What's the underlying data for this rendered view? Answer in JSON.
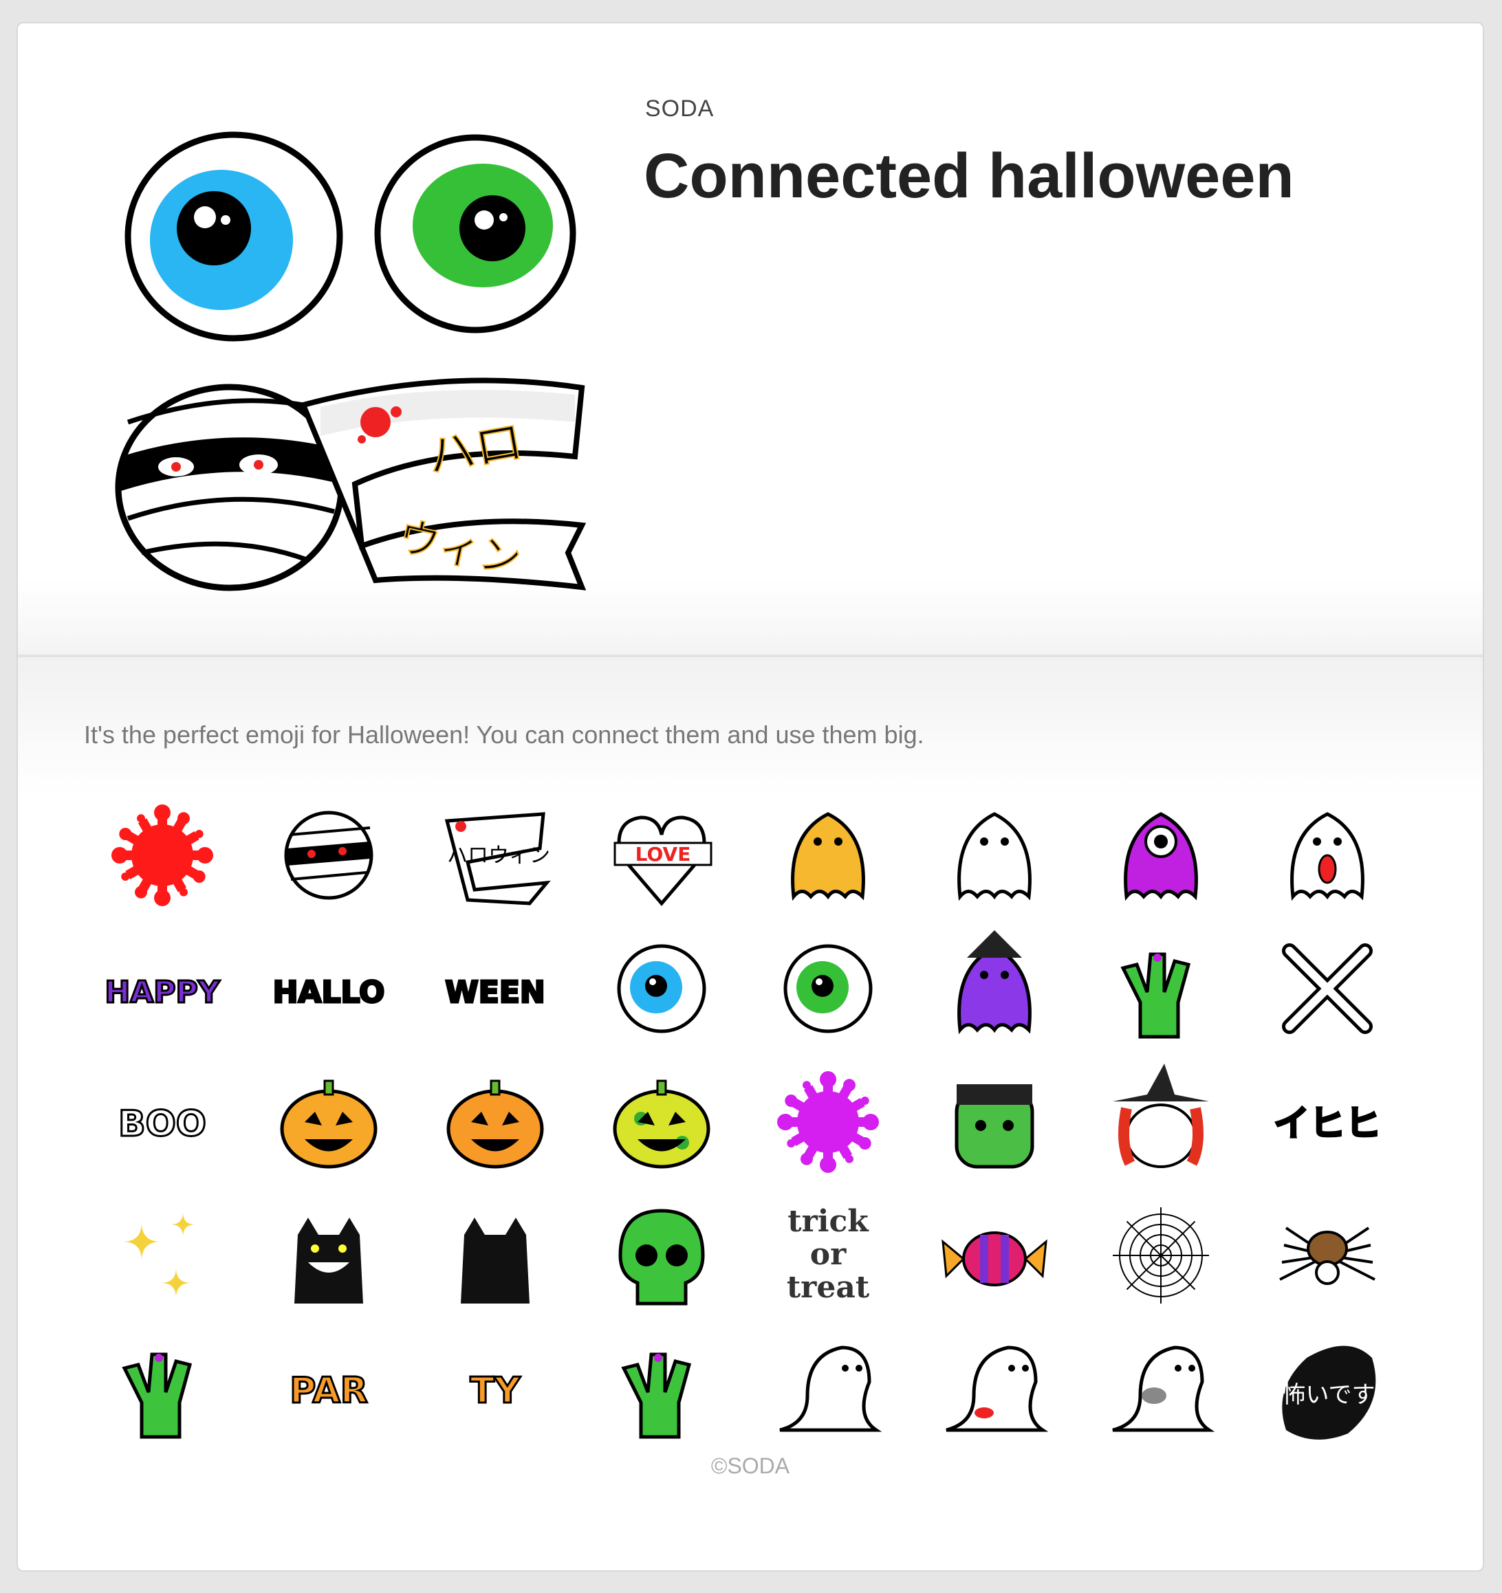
{
  "product": {
    "author": "SODA",
    "title": "Connected halloween",
    "description": "It's the perfect emoji for Halloween! You can connect them and use them big.",
    "copyright": "©SODA"
  },
  "main_image": {
    "icon": "mummy-eyeballs-main-art",
    "text_jp_1": "ハロ",
    "text_jp_2": "ウィン"
  },
  "emoji": [
    {
      "icon": "blood-splat-icon",
      "color": "#ff1a1a"
    },
    {
      "icon": "mummy-face-icon",
      "color": "#ffffff"
    },
    {
      "icon": "bandage-banner-icon",
      "color": "#ffffff",
      "text": "ハロウィン"
    },
    {
      "icon": "love-heart-icon",
      "color": "#ffffff",
      "text": "LOVE"
    },
    {
      "icon": "yellow-ghost-icon",
      "color": "#f5b82e"
    },
    {
      "icon": "white-ghost-icon",
      "color": "#ffffff"
    },
    {
      "icon": "purple-cyclops-ghost-icon",
      "color": "#c020e0"
    },
    {
      "icon": "tongue-ghost-icon",
      "color": "#ffffff"
    },
    {
      "icon": "happy-text-icon",
      "color": "#7a2fd0",
      "text": "HAPPY"
    },
    {
      "icon": "hallo-text-icon",
      "color": "#000000",
      "text": "HALLO"
    },
    {
      "icon": "ween-text-icon",
      "color": "#000000",
      "text": "WEEN"
    },
    {
      "icon": "blue-eyeball-icon",
      "color": "#27b3f2"
    },
    {
      "icon": "green-eyeball-icon",
      "color": "#36c037"
    },
    {
      "icon": "witch-ghost-icon",
      "color": "#8a38e8"
    },
    {
      "icon": "zombie-ok-hand-icon",
      "color": "#3ec43c"
    },
    {
      "icon": "crossbones-icon",
      "color": "#ffffff"
    },
    {
      "icon": "boo-text-icon",
      "color": "#ffffff",
      "text": "BOO"
    },
    {
      "icon": "jack-o-lantern-icon",
      "color": "#f7a828"
    },
    {
      "icon": "green-pumpkin-icon",
      "color": "#f79a28"
    },
    {
      "icon": "dotted-pumpkin-icon",
      "color": "#d8e42a"
    },
    {
      "icon": "purple-splat-icon",
      "color": "#d51ef0"
    },
    {
      "icon": "frankenstein-icon",
      "color": "#4bbf45"
    },
    {
      "icon": "red-hair-witch-icon",
      "color": "#e2311f"
    },
    {
      "icon": "hihi-speech-icon",
      "color": "#ffffff",
      "text": "イヒヒ"
    },
    {
      "icon": "sparkles-icon",
      "color": "#f5d23c"
    },
    {
      "icon": "grinning-black-cat-icon",
      "color": "#111111"
    },
    {
      "icon": "black-cat-silhouette-icon",
      "color": "#111111"
    },
    {
      "icon": "green-skull-icon",
      "color": "#3ec43c"
    },
    {
      "icon": "trick-or-treat-text-icon",
      "color": "#333333",
      "text_lines": [
        "trick",
        "or",
        "treat"
      ]
    },
    {
      "icon": "wrapped-candy-icon",
      "color": "#e0206e"
    },
    {
      "icon": "spider-web-icon",
      "color": "#ffffff"
    },
    {
      "icon": "spider-icon",
      "color": "#111111"
    },
    {
      "icon": "zombie-hand-icon",
      "color": "#3ec43c"
    },
    {
      "icon": "party-text-icon-1",
      "color": "#f79a28",
      "text": "PAR"
    },
    {
      "icon": "party-text-icon-2",
      "color": "#f79a28",
      "text": "TY"
    },
    {
      "icon": "zombie-pointing-hand-icon",
      "color": "#3ec43c"
    },
    {
      "icon": "ghost-tail-swoosh-icon",
      "color": "#ffffff"
    },
    {
      "icon": "ghost-tongue-swoosh-icon",
      "color": "#ffffff"
    },
    {
      "icon": "screaming-ghost-icon",
      "color": "#ffffff"
    },
    {
      "icon": "kowai-black-blob-icon",
      "color": "#111111",
      "text": "怖いです"
    }
  ]
}
